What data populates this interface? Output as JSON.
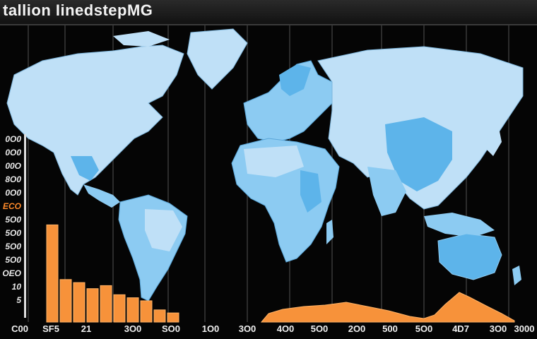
{
  "title": "tallion IinedstepMG",
  "colors": {
    "background": "#050505",
    "land": "#bfe0f7",
    "land_dark": "#5db4ea",
    "land_mid": "#8ccbf2",
    "bars": "#f7923a",
    "grid": "#2c2c2c"
  },
  "y_axis_ticks": [
    {
      "label": "0O0",
      "highlight": false
    },
    {
      "label": "0O0",
      "highlight": false
    },
    {
      "label": "00O",
      "highlight": false
    },
    {
      "label": "8O0",
      "highlight": false
    },
    {
      "label": "0O0",
      "highlight": false
    },
    {
      "label": "ECO",
      "highlight": true
    },
    {
      "label": "5O0",
      "highlight": false
    },
    {
      "label": "5O0",
      "highlight": false
    },
    {
      "label": "5O0",
      "highlight": false
    },
    {
      "label": "5O0",
      "highlight": false
    },
    {
      "label": "OEO",
      "highlight": false
    },
    {
      "label": "10",
      "highlight": false
    },
    {
      "label": "5",
      "highlight": false
    }
  ],
  "x_axis_ticks": [
    "C00",
    "SF5",
    "21",
    "3O0",
    "SO0",
    "1O0",
    "3O0",
    "4O0",
    "5O0",
    "2O0",
    "500",
    "5O0",
    "4D7",
    "3O0",
    "3000"
  ],
  "bar_values": [
    32,
    14,
    13,
    11,
    12,
    9,
    8,
    7,
    4,
    3
  ]
}
